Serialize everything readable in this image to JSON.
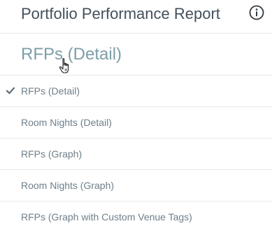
{
  "header": {
    "title": "Portfolio Performance Report",
    "info_icon": "info-circle-icon"
  },
  "report_selector": {
    "current_label": "RFPs (Detail)"
  },
  "menu": {
    "items": [
      {
        "label": "RFPs (Detail)",
        "selected": true
      },
      {
        "label": "Room Nights (Detail)",
        "selected": false
      },
      {
        "label": "RFPs (Graph)",
        "selected": false
      },
      {
        "label": "Room Nights (Graph)",
        "selected": false
      },
      {
        "label": "RFPs (Graph with Custom Venue Tags)",
        "selected": false
      }
    ]
  },
  "colors": {
    "title_text": "#44505c",
    "selector_text": "#7d9ea8",
    "menu_text": "#6f7f8a",
    "divider": "#e3e6ea",
    "check": "#5f6c78"
  }
}
